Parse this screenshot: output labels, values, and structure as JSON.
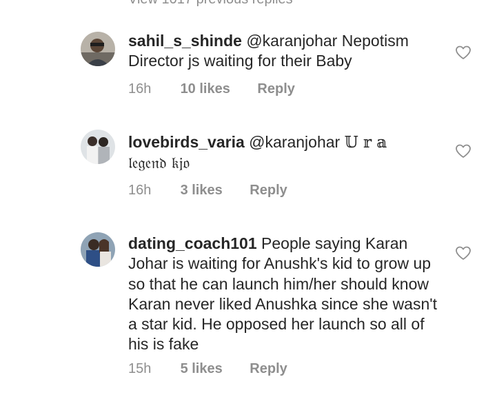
{
  "header": {
    "previous_replies": "View 1017 previous replies"
  },
  "comments": [
    {
      "username": "sahil_s_shinde",
      "mention": "@karanjohar",
      "text_line1": "Nepotism",
      "text_rest": "Director js waiting for their Baby",
      "time": "16h",
      "likes": "10 likes",
      "reply": "Reply",
      "avatar_icon": "avatar-photo"
    },
    {
      "username": "lovebirds_varia",
      "mention": "@karanjohar",
      "text_line1": "𝕌 𝕣 𝕒",
      "text_rest": "𝔩𝔢𝔤𝔢𝔫𝔡 𝔨𝔧𝔬",
      "time": "16h",
      "likes": "3 likes",
      "reply": "Reply",
      "avatar_icon": "avatar-photo"
    },
    {
      "username": "dating_coach101",
      "text": "People saying Karan Johar is waiting for Anushk's kid to grow up so that he can launch him/her should know Karan never liked Anushka since she wasn't a star kid. He opposed her launch so all of his is fake",
      "time": "15h",
      "likes": "5 likes",
      "reply": "Reply",
      "avatar_icon": "avatar-photo"
    }
  ],
  "icons": {
    "like": "heart-outline-icon"
  },
  "colors": {
    "text": "#262626",
    "secondary": "#8e8e8e",
    "background": "#ffffff"
  }
}
